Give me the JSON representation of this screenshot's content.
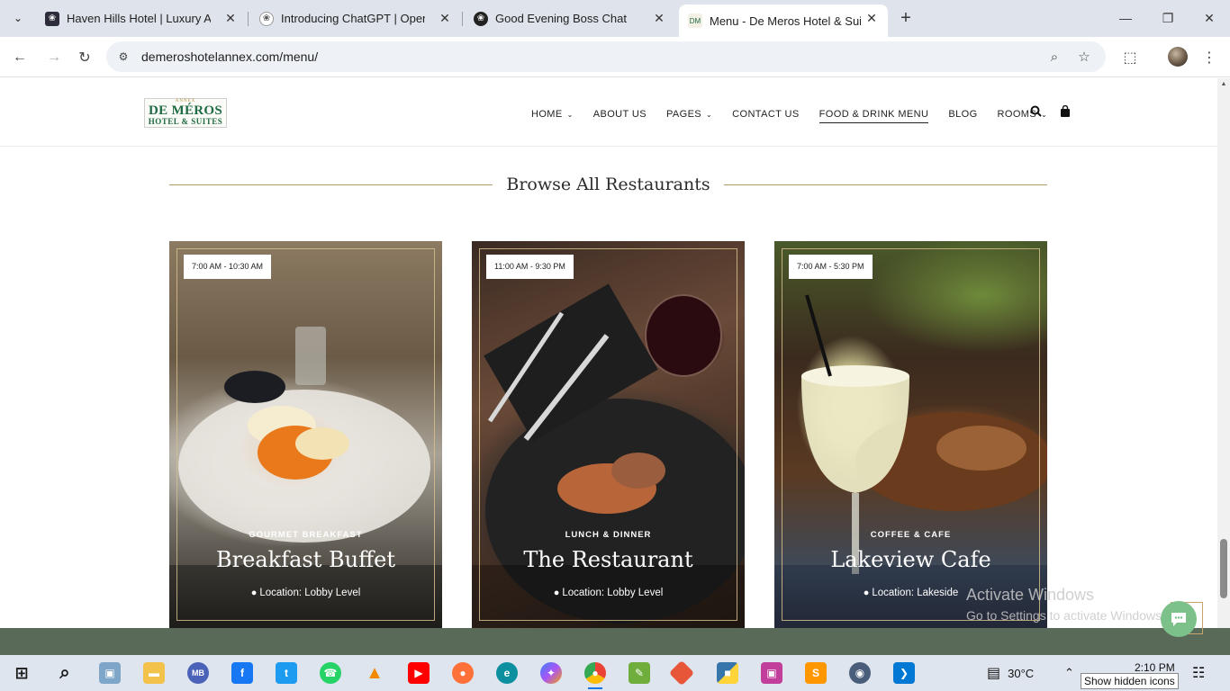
{
  "browser": {
    "tabs": [
      {
        "title": "Haven Hills Hotel | Luxury And",
        "favicon": "haven-hills-favicon"
      },
      {
        "title": "Introducing ChatGPT | OpenAI",
        "favicon": "openai-favicon"
      },
      {
        "title": "Good Evening Boss Chat",
        "favicon": "openai-favicon"
      },
      {
        "title": "Menu - De Meros Hotel & Suite",
        "favicon": "de-meros-favicon",
        "active": true
      }
    ],
    "url": "demeroshotelannex.com/menu/"
  },
  "site": {
    "logo": {
      "top": "ANNEX",
      "main": "DE MÉROS",
      "sub": "HOTEL & SUITES"
    },
    "nav": [
      {
        "label": "HOME",
        "dropdown": true
      },
      {
        "label": "ABOUT US",
        "dropdown": false
      },
      {
        "label": "PAGES",
        "dropdown": true
      },
      {
        "label": "CONTACT US",
        "dropdown": false
      },
      {
        "label": "FOOD & DRINK MENU",
        "dropdown": false,
        "active": true
      },
      {
        "label": "BLOG",
        "dropdown": false
      },
      {
        "label": "ROOMS",
        "dropdown": true
      }
    ],
    "section_title": "Browse All Restaurants",
    "cards": [
      {
        "hours": "7:00 AM - 10:30 AM",
        "category": "GOURMET BREAKFAST",
        "name": "Breakfast Buffet",
        "location": "Location: Lobby Level"
      },
      {
        "hours": "11:00 AM - 9:30 PM",
        "category": "LUNCH & DINNER",
        "name": "The Restaurant",
        "location": "Location: Lobby Level"
      },
      {
        "hours": "7:00 AM - 5:30 PM",
        "category": "COFFEE & CAFE",
        "name": "Lakeview Cafe",
        "location": "Location: Lakeside"
      }
    ],
    "colors": {
      "accent": "#b29a6b",
      "logo_green": "#1f6b43",
      "footer": "#5a6a58"
    }
  },
  "watermark": {
    "line1": "Activate Windows",
    "line2": "Go to Settings to activate Windows."
  },
  "taskbar": {
    "apps": [
      "windows-start",
      "search",
      "remote-desktop",
      "file-explorer",
      "mb-app",
      "facebook",
      "twitter",
      "whatsapp",
      "vlc",
      "youtube",
      "firefox",
      "edge",
      "copilot",
      "chrome",
      "notepad-plus",
      "git",
      "python",
      "phpstorm",
      "sublime",
      "photos",
      "vscode"
    ],
    "temperature": "30°C",
    "time": "2:10 PM",
    "tooltip": "Show hidden icons"
  }
}
